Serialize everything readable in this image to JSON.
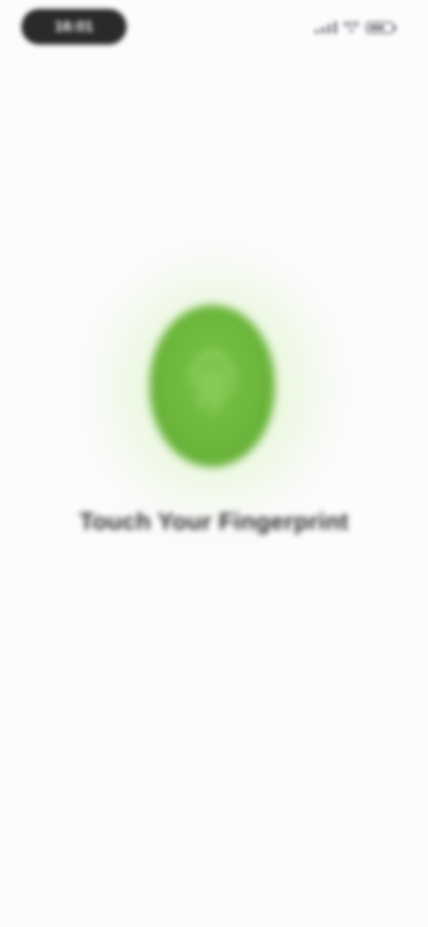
{
  "status_bar": {
    "time": "16:01"
  },
  "auth": {
    "prompt": "Touch Your Fingerprint"
  },
  "colors": {
    "background": "#fcfbfd",
    "accent_green": "#6cb63c",
    "text": "#2d2d30"
  },
  "icons": [
    "signal-icon",
    "wifi-icon",
    "battery-icon",
    "fingerprint-icon"
  ]
}
